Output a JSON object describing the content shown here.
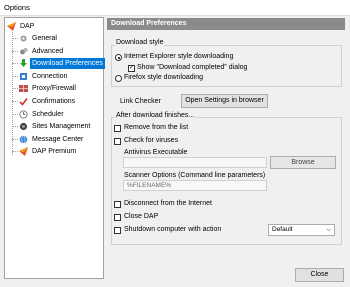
{
  "window": {
    "title": "Options"
  },
  "tree": {
    "root": "DAP",
    "items": [
      {
        "label": "General",
        "icon": "gear-icon"
      },
      {
        "label": "Advanced",
        "icon": "gears-icon"
      },
      {
        "label": "Download Preferences",
        "icon": "download-arrow-icon"
      },
      {
        "label": "Connection",
        "icon": "connection-icon"
      },
      {
        "label": "Proxy/Firewall",
        "icon": "firewall-icon"
      },
      {
        "label": "Confirmations",
        "icon": "checkmark-icon"
      },
      {
        "label": "Scheduler",
        "icon": "clock-icon"
      },
      {
        "label": "Sites Management",
        "icon": "sites-icon"
      },
      {
        "label": "Message Center",
        "icon": "globe-icon"
      },
      {
        "label": "DAP Premium",
        "icon": "premium-icon"
      }
    ]
  },
  "panel": {
    "header": "Download Preferences",
    "download_style": {
      "title": "Download style",
      "ie_style": "Internet Explorer style downloading",
      "show_dialog": "Show \"Download completed\" dialog",
      "firefox_style": "Firefox style downloading"
    },
    "link_checker": {
      "label": "Link Checker",
      "button": "Open Settings in browser"
    },
    "after_download": {
      "title": "After download finishes...",
      "remove": "Remove from the list",
      "check_viruses": "Check for viruses",
      "antivirus_label": "Antivirus Executable",
      "browse": "Browse",
      "scanner_label": "Scanner Options (Command line parameters)",
      "scanner_value": "%FILENAME%",
      "disconnect": "Disconnect from the Internet",
      "close_dap": "Close DAP",
      "shutdown": "Shutdown computer with action",
      "shutdown_action": "Default"
    }
  },
  "footer": {
    "close": "Close"
  }
}
